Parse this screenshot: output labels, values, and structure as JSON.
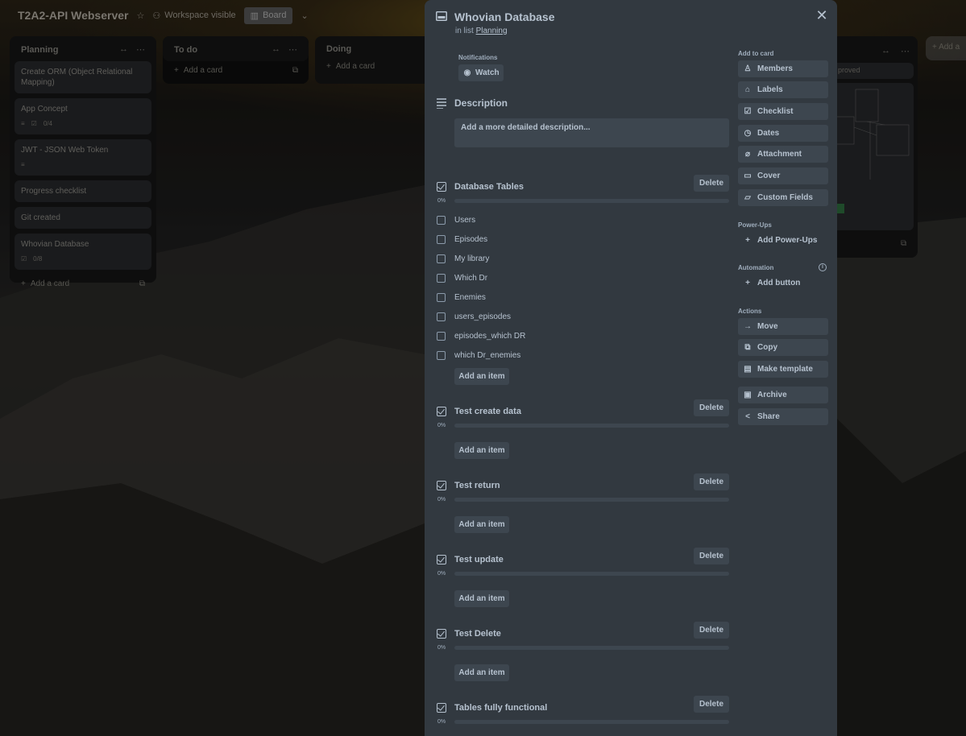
{
  "board": {
    "title": "T2A2-API Webserver",
    "visibility": "Workspace visible",
    "view": "Board"
  },
  "lists": [
    {
      "title": "Planning",
      "cards": [
        {
          "title": "Create ORM (Object Relational Mapping)"
        },
        {
          "title": "App Concept",
          "checklist_badge": "0/4"
        },
        {
          "title": "JWT - JSON Web Token"
        },
        {
          "title": "Progress checklist"
        },
        {
          "title": "Git created"
        },
        {
          "title": "Whovian Database",
          "checklist_badge": "0/8"
        }
      ],
      "add_card": "Add a card"
    },
    {
      "title": "To do",
      "add_card": "Add a card"
    },
    {
      "title": "Doing",
      "add_card": "Add a card"
    }
  ],
  "right_list": {
    "card_text": "proved"
  },
  "add_another": "+ Add a",
  "modal": {
    "title": "Whovian Database",
    "in_list_prefix": "in list",
    "in_list_link": "Planning",
    "notifications_label": "Notifications",
    "watch_label": "Watch",
    "description_title": "Description",
    "description_placeholder": "Add a more detailed description...",
    "checklists": [
      {
        "title": "Database Tables",
        "percent": "0%",
        "progress": 0,
        "delete_label": "Delete",
        "items": [
          "Users",
          "Episodes",
          "My library",
          "Which Dr",
          "Enemies",
          "users_episodes",
          "episodes_which DR",
          "which Dr_enemies"
        ],
        "add_item_label": "Add an item"
      },
      {
        "title": "Test create data",
        "percent": "0%",
        "progress": 0,
        "delete_label": "Delete",
        "items": [],
        "add_item_label": "Add an item"
      },
      {
        "title": "Test return",
        "percent": "0%",
        "progress": 0,
        "delete_label": "Delete",
        "items": [],
        "add_item_label": "Add an item"
      },
      {
        "title": "Test update",
        "percent": "0%",
        "progress": 0,
        "delete_label": "Delete",
        "items": [],
        "add_item_label": "Add an item"
      },
      {
        "title": "Test Delete",
        "percent": "0%",
        "progress": 0,
        "delete_label": "Delete",
        "items": [],
        "add_item_label": "Add an item"
      },
      {
        "title": "Tables fully functional",
        "percent": "0%",
        "progress": 0,
        "delete_label": "Delete",
        "items": []
      }
    ],
    "sidebar": {
      "add_to_card_label": "Add to card",
      "add_to_card": [
        {
          "label": "Members",
          "icon": "person-icon"
        },
        {
          "label": "Labels",
          "icon": "tag-icon"
        },
        {
          "label": "Checklist",
          "icon": "checklist-icon"
        },
        {
          "label": "Dates",
          "icon": "clock-icon"
        },
        {
          "label": "Attachment",
          "icon": "paperclip-icon"
        },
        {
          "label": "Cover",
          "icon": "cover-icon"
        },
        {
          "label": "Custom Fields",
          "icon": "folder-icon"
        }
      ],
      "powerups_label": "Power-Ups",
      "add_powerups": "Add Power-Ups",
      "automation_label": "Automation",
      "add_button": "Add button",
      "actions_label": "Actions",
      "actions": [
        {
          "label": "Move",
          "icon": "arrow-right-icon"
        },
        {
          "label": "Copy",
          "icon": "copy-icon"
        },
        {
          "label": "Make template",
          "icon": "template-icon"
        },
        {
          "label": "Archive",
          "icon": "archive-icon"
        },
        {
          "label": "Share",
          "icon": "share-icon"
        }
      ]
    }
  },
  "colors": {
    "modal_bg": "#323940",
    "button_bg": "#3d464f",
    "text": "#b6c2cf",
    "list_bg": "#0e0e0e"
  }
}
